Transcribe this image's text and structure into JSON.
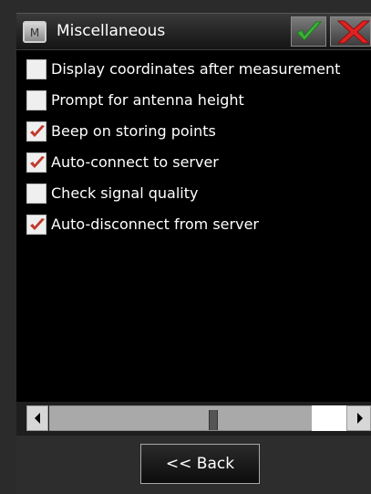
{
  "window": {
    "title": "Miscellaneous",
    "app_icon_letter": "M"
  },
  "options": [
    {
      "label": "Display coordinates after measurement",
      "checked": false
    },
    {
      "label": "Prompt for antenna height",
      "checked": false
    },
    {
      "label": "Beep on storing points",
      "checked": true
    },
    {
      "label": "Auto-connect to server",
      "checked": true
    },
    {
      "label": "Check signal quality",
      "checked": false
    },
    {
      "label": "Auto-disconnect from server",
      "checked": true
    }
  ],
  "footer": {
    "back_label": "<< Back"
  },
  "colors": {
    "ok_check": "#3db23a",
    "cancel_x": "#e02222",
    "checkmark": "#c0392b"
  },
  "icons": {
    "ok": "checkmark-icon",
    "cancel": "close-icon",
    "app": "app-logo-icon",
    "scroll_left": "arrow-left-icon",
    "scroll_right": "arrow-right-icon"
  }
}
